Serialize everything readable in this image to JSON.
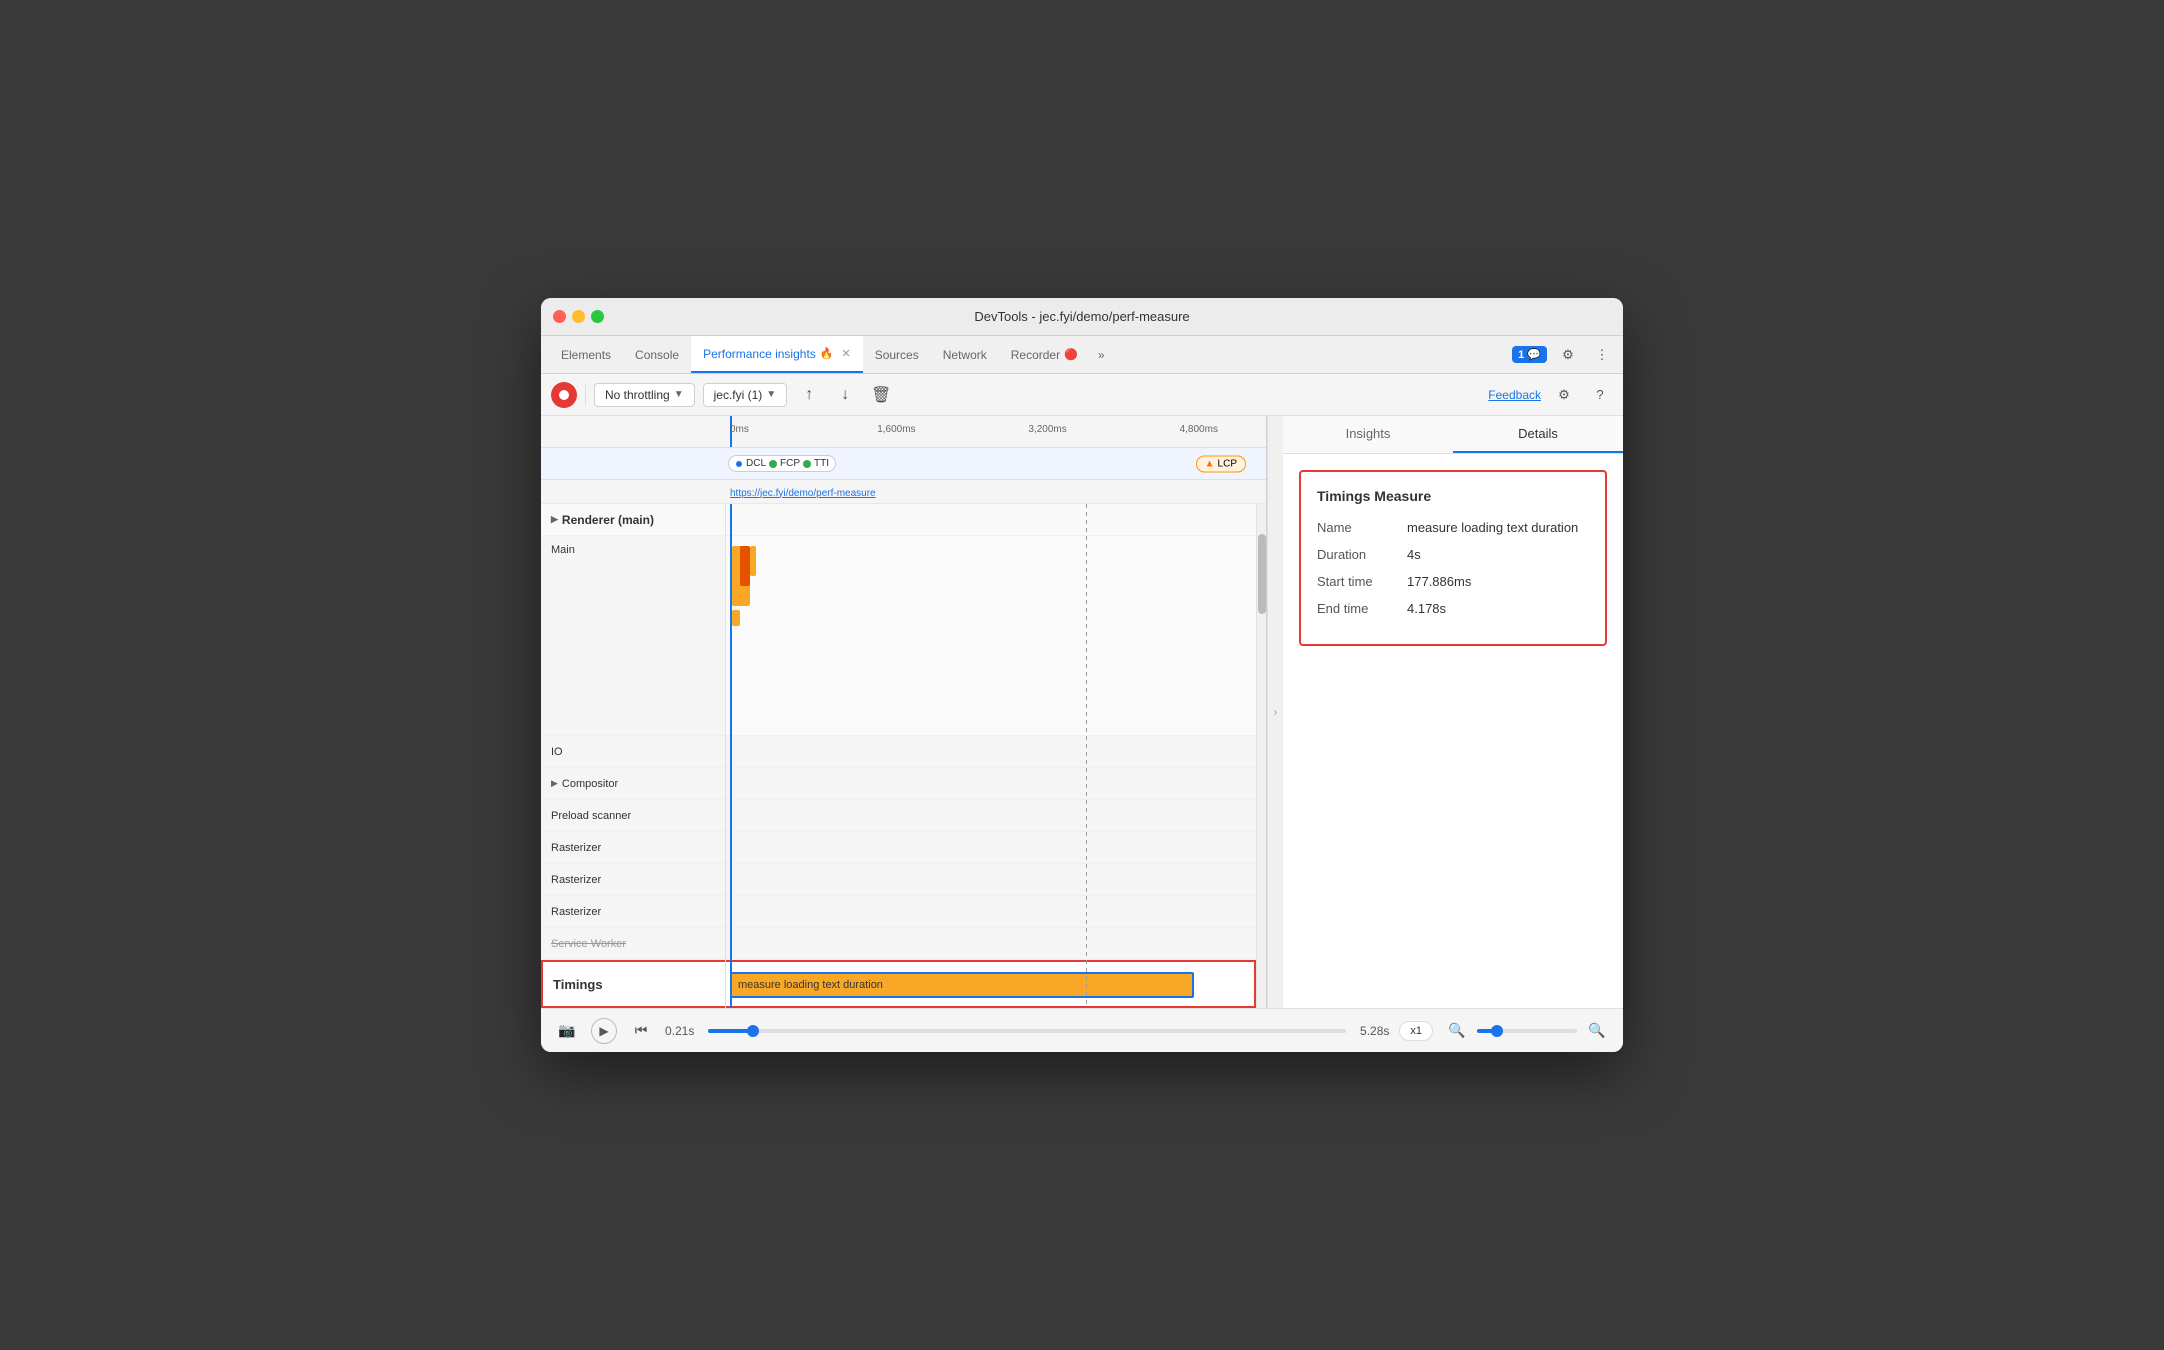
{
  "window": {
    "title": "DevTools - jec.fyi/demo/perf-measure"
  },
  "tabs": {
    "items": [
      {
        "label": "Elements",
        "active": false
      },
      {
        "label": "Console",
        "active": false
      },
      {
        "label": "Performance insights",
        "active": true
      },
      {
        "label": "Sources",
        "active": false
      },
      {
        "label": "Network",
        "active": false
      },
      {
        "label": "Recorder",
        "active": false
      }
    ],
    "more_label": "»",
    "chat_badge": "1"
  },
  "toolbar": {
    "record_label": "",
    "throttling_label": "No throttling",
    "site_label": "jec.fyi (1)",
    "feedback_label": "Feedback"
  },
  "timeline": {
    "markers": [
      "0ms",
      "1,600ms",
      "3,200ms",
      "4,800ms"
    ],
    "milestones": {
      "dcl_label": "DCL",
      "fcp_label": "FCP",
      "tti_label": "TTI",
      "lcp_label": "LCP"
    },
    "url": "https://jec.fyi/demo/perf-measure",
    "tracks": [
      {
        "label": "Renderer (main)",
        "type": "header",
        "expanded": true
      },
      {
        "label": "Main",
        "type": "main"
      },
      {
        "label": "IO",
        "type": "normal"
      },
      {
        "label": "Compositor",
        "type": "normal",
        "has_expand": true
      },
      {
        "label": "Preload scanner",
        "type": "normal"
      },
      {
        "label": "Rasterizer",
        "type": "normal"
      },
      {
        "label": "Rasterizer",
        "type": "normal"
      },
      {
        "label": "Rasterizer",
        "type": "normal"
      },
      {
        "label": "Service Worker",
        "type": "strikethrough"
      },
      {
        "label": "Timings",
        "type": "timings"
      }
    ]
  },
  "timings_measure": {
    "label": "measure loading text duration"
  },
  "right_panel": {
    "tabs": [
      "Insights",
      "Details"
    ],
    "active_tab": "Details",
    "details": {
      "title": "Timings Measure",
      "rows": [
        {
          "label": "Name",
          "value": "measure loading text duration"
        },
        {
          "label": "Duration",
          "value": "4s"
        },
        {
          "label": "Start time",
          "value": "177.886ms"
        },
        {
          "label": "End time",
          "value": "4.178s"
        }
      ]
    }
  },
  "bottom_bar": {
    "time_start": "0.21s",
    "time_end": "5.28s",
    "speed_label": "x1",
    "zoom_minus": "−",
    "zoom_plus": "+"
  }
}
